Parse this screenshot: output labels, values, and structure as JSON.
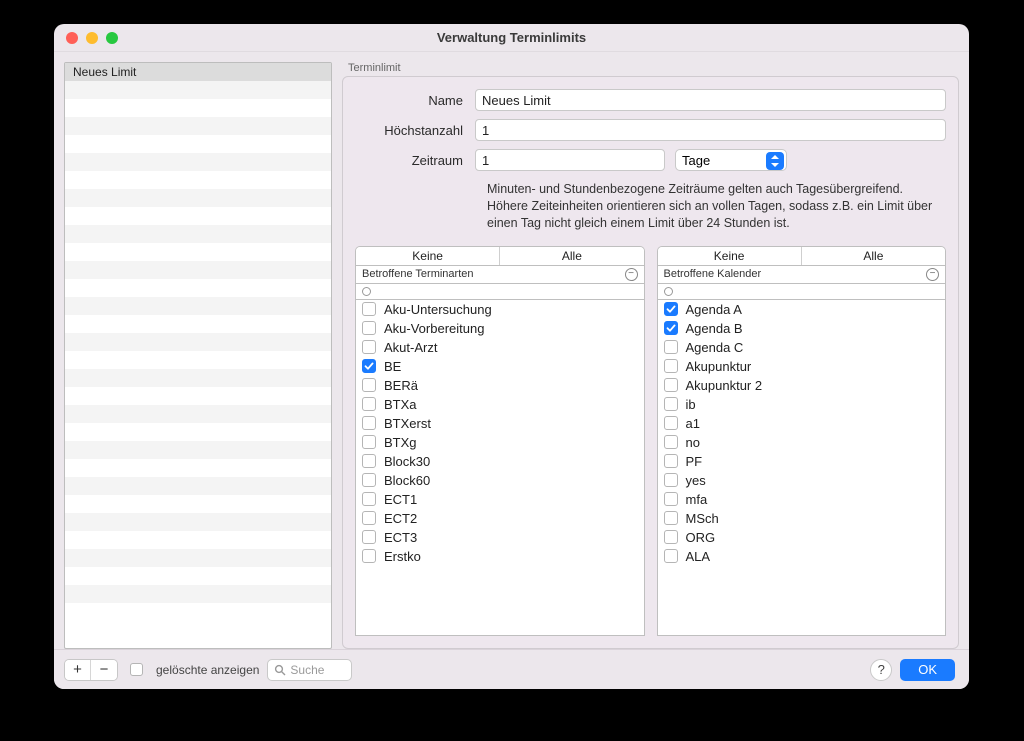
{
  "window": {
    "title": "Verwaltung Terminlimits"
  },
  "sidebar": {
    "items": [
      "Neues Limit"
    ],
    "emptyRows": 30
  },
  "group": {
    "label": "Terminlimit"
  },
  "form": {
    "name_label": "Name",
    "name_value": "Neues Limit",
    "max_label": "Höchstanzahl",
    "max_value": "1",
    "period_label": "Zeitraum",
    "period_value": "1",
    "period_unit": "Tage",
    "help": "Minuten- und Stundenbezogene Zeiträume gelten auch Tagesübergreifend. Höhere Zeiteinheiten orientieren sich an vollen Tagen, sodass z.B. ein Limit über einen Tag nicht gleich einem Limit über 24 Stunden ist."
  },
  "segments": {
    "none": "Keine",
    "all": "Alle"
  },
  "terminarten": {
    "header": "Betroffene Terminarten",
    "items": [
      {
        "label": "Aku-Untersuchung",
        "checked": false
      },
      {
        "label": "Aku-Vorbereitung",
        "checked": false
      },
      {
        "label": "Akut-Arzt",
        "checked": false
      },
      {
        "label": "BE",
        "checked": true
      },
      {
        "label": "BERä",
        "checked": false
      },
      {
        "label": "BTXa",
        "checked": false
      },
      {
        "label": "BTXerst",
        "checked": false
      },
      {
        "label": "BTXg",
        "checked": false
      },
      {
        "label": "Block30",
        "checked": false
      },
      {
        "label": "Block60",
        "checked": false
      },
      {
        "label": "ECT1",
        "checked": false
      },
      {
        "label": "ECT2",
        "checked": false
      },
      {
        "label": "ECT3",
        "checked": false
      },
      {
        "label": "Erstko",
        "checked": false
      }
    ]
  },
  "kalender": {
    "header": "Betroffene Kalender",
    "items": [
      {
        "label": "Agenda A",
        "checked": true
      },
      {
        "label": "Agenda B",
        "checked": true
      },
      {
        "label": "Agenda C",
        "checked": false
      },
      {
        "label": "Akupunktur",
        "checked": false
      },
      {
        "label": "Akupunktur 2",
        "checked": false
      },
      {
        "label": "ib",
        "checked": false
      },
      {
        "label": "a1",
        "checked": false
      },
      {
        "label": "no",
        "checked": false
      },
      {
        "label": "PF",
        "checked": false
      },
      {
        "label": "yes",
        "checked": false
      },
      {
        "label": "mfa",
        "checked": false
      },
      {
        "label": "MSch",
        "checked": false
      },
      {
        "label": "ORG",
        "checked": false
      },
      {
        "label": "ALA",
        "checked": false
      }
    ]
  },
  "footer": {
    "show_deleted": "gelöschte anzeigen",
    "search_placeholder": "Suche",
    "ok": "OK"
  }
}
